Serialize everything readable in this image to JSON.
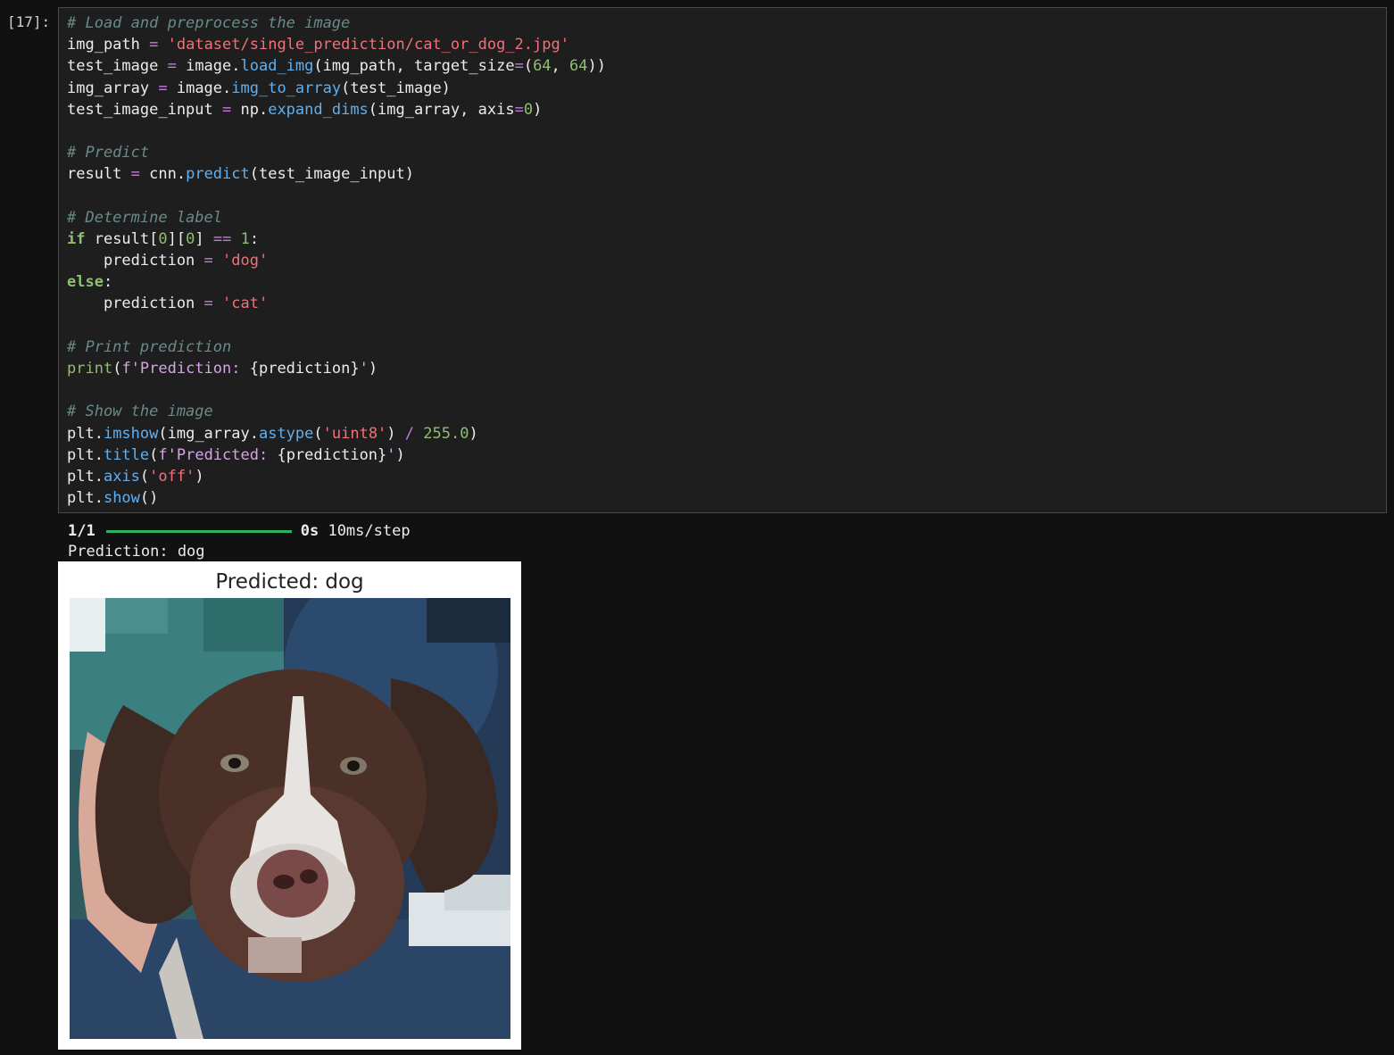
{
  "cell": {
    "prompt": "[17]:",
    "lines": [
      [
        {
          "t": "cm",
          "v": "# Load and preprocess the image"
        }
      ],
      [
        {
          "t": "tx",
          "v": "img_path "
        },
        {
          "t": "op",
          "v": "="
        },
        {
          "t": "tx",
          "v": " "
        },
        {
          "t": "st",
          "v": "'dataset/single_prediction/cat_or_dog_2.jpg'"
        }
      ],
      [
        {
          "t": "tx",
          "v": "test_image "
        },
        {
          "t": "op",
          "v": "="
        },
        {
          "t": "tx",
          "v": " image."
        },
        {
          "t": "fn",
          "v": "load_img"
        },
        {
          "t": "tx",
          "v": "(img_path, target_size"
        },
        {
          "t": "op",
          "v": "="
        },
        {
          "t": "tx",
          "v": "("
        },
        {
          "t": "nu",
          "v": "64"
        },
        {
          "t": "tx",
          "v": ", "
        },
        {
          "t": "nu",
          "v": "64"
        },
        {
          "t": "tx",
          "v": "))"
        }
      ],
      [
        {
          "t": "tx",
          "v": "img_array "
        },
        {
          "t": "op",
          "v": "="
        },
        {
          "t": "tx",
          "v": " image."
        },
        {
          "t": "fn",
          "v": "img_to_array"
        },
        {
          "t": "tx",
          "v": "(test_image)"
        }
      ],
      [
        {
          "t": "tx",
          "v": "test_image_input "
        },
        {
          "t": "op",
          "v": "="
        },
        {
          "t": "tx",
          "v": " np."
        },
        {
          "t": "fn",
          "v": "expand_dims"
        },
        {
          "t": "tx",
          "v": "(img_array, axis"
        },
        {
          "t": "op",
          "v": "="
        },
        {
          "t": "nu",
          "v": "0"
        },
        {
          "t": "tx",
          "v": ")"
        }
      ],
      [],
      [
        {
          "t": "cm",
          "v": "# Predict"
        }
      ],
      [
        {
          "t": "tx",
          "v": "result "
        },
        {
          "t": "op",
          "v": "="
        },
        {
          "t": "tx",
          "v": " cnn."
        },
        {
          "t": "fn",
          "v": "predict"
        },
        {
          "t": "tx",
          "v": "(test_image_input)"
        }
      ],
      [],
      [
        {
          "t": "cm",
          "v": "# Determine label"
        }
      ],
      [
        {
          "t": "kw",
          "v": "if"
        },
        {
          "t": "tx",
          "v": " result["
        },
        {
          "t": "nu",
          "v": "0"
        },
        {
          "t": "tx",
          "v": "]["
        },
        {
          "t": "nu",
          "v": "0"
        },
        {
          "t": "tx",
          "v": "] "
        },
        {
          "t": "op",
          "v": "=="
        },
        {
          "t": "tx",
          "v": " "
        },
        {
          "t": "nu",
          "v": "1"
        },
        {
          "t": "tx",
          "v": ":"
        }
      ],
      [
        {
          "t": "tx",
          "v": "    prediction "
        },
        {
          "t": "op",
          "v": "="
        },
        {
          "t": "tx",
          "v": " "
        },
        {
          "t": "st",
          "v": "'dog'"
        }
      ],
      [
        {
          "t": "kw",
          "v": "else"
        },
        {
          "t": "tx",
          "v": ":"
        }
      ],
      [
        {
          "t": "tx",
          "v": "    prediction "
        },
        {
          "t": "op",
          "v": "="
        },
        {
          "t": "tx",
          "v": " "
        },
        {
          "t": "st",
          "v": "'cat'"
        }
      ],
      [],
      [
        {
          "t": "cm",
          "v": "# Print prediction"
        }
      ],
      [
        {
          "t": "bi",
          "v": "print"
        },
        {
          "t": "tx",
          "v": "("
        },
        {
          "t": "fs",
          "v": "f'Prediction: "
        },
        {
          "t": "tx",
          "v": "{prediction}"
        },
        {
          "t": "fs",
          "v": "'"
        },
        {
          "t": "tx",
          "v": ")"
        }
      ],
      [],
      [
        {
          "t": "cm",
          "v": "# Show the image"
        }
      ],
      [
        {
          "t": "tx",
          "v": "plt."
        },
        {
          "t": "fn",
          "v": "imshow"
        },
        {
          "t": "tx",
          "v": "(img_array."
        },
        {
          "t": "fn",
          "v": "astype"
        },
        {
          "t": "tx",
          "v": "("
        },
        {
          "t": "st",
          "v": "'uint8'"
        },
        {
          "t": "tx",
          "v": ") "
        },
        {
          "t": "op",
          "v": "/"
        },
        {
          "t": "tx",
          "v": " "
        },
        {
          "t": "nu",
          "v": "255.0"
        },
        {
          "t": "tx",
          "v": ")"
        }
      ],
      [
        {
          "t": "tx",
          "v": "plt."
        },
        {
          "t": "fn",
          "v": "title"
        },
        {
          "t": "tx",
          "v": "("
        },
        {
          "t": "fs",
          "v": "f'Predicted: "
        },
        {
          "t": "tx",
          "v": "{prediction}"
        },
        {
          "t": "fs",
          "v": "'"
        },
        {
          "t": "tx",
          "v": ")"
        }
      ],
      [
        {
          "t": "tx",
          "v": "plt."
        },
        {
          "t": "fn",
          "v": "axis"
        },
        {
          "t": "tx",
          "v": "("
        },
        {
          "t": "st",
          "v": "'off'"
        },
        {
          "t": "tx",
          "v": ")"
        }
      ],
      [
        {
          "t": "tx",
          "v": "plt."
        },
        {
          "t": "fn",
          "v": "show"
        },
        {
          "t": "tx",
          "v": "()"
        }
      ]
    ]
  },
  "output": {
    "progress_count": "1/1",
    "progress_fraction": 1.0,
    "progress_time": "0s",
    "progress_rate": "10ms/step",
    "prediction_text": "Prediction: dog"
  },
  "figure": {
    "title": "Predicted: dog"
  },
  "colors": {
    "background": "#111111",
    "cell_background": "#1e1e1e",
    "progress": "#2fb35a"
  }
}
